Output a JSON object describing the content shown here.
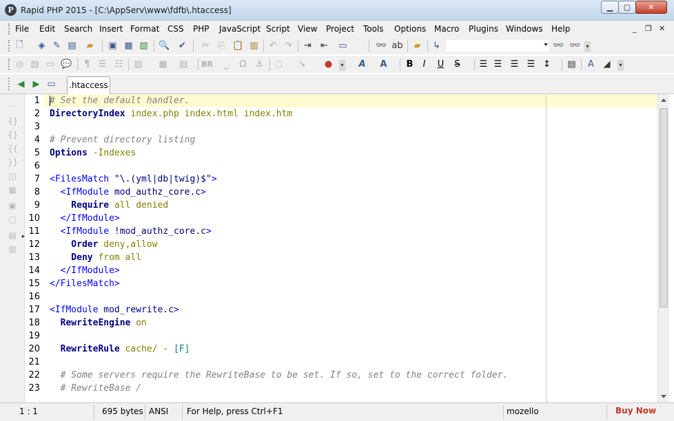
{
  "window": {
    "app_icon": "P",
    "title": "Rapid PHP 2015 - [C:\\AppServ\\www\\fdfb\\.htaccess]",
    "min_glyph": "▁",
    "max_glyph": "▢",
    "close_glyph": "✕"
  },
  "menu": {
    "items": [
      {
        "label": "File"
      },
      {
        "label": "Edit"
      },
      {
        "label": "Search"
      },
      {
        "label": "Insert"
      },
      {
        "label": "Format"
      },
      {
        "label": "CSS"
      },
      {
        "label": "PHP"
      },
      {
        "label": "JavaScript"
      },
      {
        "label": "Script"
      },
      {
        "label": "View"
      },
      {
        "label": "Project"
      },
      {
        "label": "Tools"
      },
      {
        "label": "Options"
      },
      {
        "label": "Macro"
      },
      {
        "label": "Plugins"
      },
      {
        "label": "Windows"
      },
      {
        "label": "Help"
      }
    ],
    "mdi_min": "_",
    "mdi_restore": "❐",
    "mdi_close": "✕"
  },
  "toolbar": {
    "format_labels": {
      "br": "BR",
      "bold": "B",
      "italic": "I",
      "underline": "U",
      "strike": "S",
      "font": "A",
      "size": "A"
    }
  },
  "tabs": [
    {
      "label": ".htaccess",
      "active": true
    }
  ],
  "editor": {
    "lines": [
      {
        "n": "1",
        "parts": [
          {
            "t": "# Set the default handler.",
            "c": "com"
          }
        ]
      },
      {
        "n": "2",
        "parts": [
          {
            "t": "DirectoryIndex",
            "c": "dir"
          },
          {
            "t": " index.php index.html index.htm",
            "c": "arg"
          }
        ]
      },
      {
        "n": "3",
        "parts": []
      },
      {
        "n": "4",
        "parts": [
          {
            "t": "# Prevent directory listing",
            "c": "com"
          }
        ]
      },
      {
        "n": "5",
        "parts": [
          {
            "t": "Options",
            "c": "dir"
          },
          {
            "t": " -Indexes",
            "c": "arg"
          }
        ]
      },
      {
        "n": "6",
        "parts": []
      },
      {
        "n": "7",
        "parts": [
          {
            "t": "<FilesMatch ",
            "c": "tag"
          },
          {
            "t": "\"\\.(yml|db|twig)$\"",
            "c": "str"
          },
          {
            "t": ">",
            "c": "tag"
          }
        ]
      },
      {
        "n": "8",
        "parts": [
          {
            "t": "  <IfModule ",
            "c": "tag"
          },
          {
            "t": "mod_authz_core.c",
            "c": "str"
          },
          {
            "t": ">",
            "c": "tag"
          }
        ]
      },
      {
        "n": "9",
        "parts": [
          {
            "t": "    Require",
            "c": "dir"
          },
          {
            "t": " all denied",
            "c": "arg"
          }
        ]
      },
      {
        "n": "10",
        "parts": [
          {
            "t": "  </IfModule>",
            "c": "tag"
          }
        ]
      },
      {
        "n": "11",
        "parts": [
          {
            "t": "  <IfModule ",
            "c": "tag"
          },
          {
            "t": "!mod_authz_core.c",
            "c": "str"
          },
          {
            "t": ">",
            "c": "tag"
          }
        ]
      },
      {
        "n": "12",
        "parts": [
          {
            "t": "    Order",
            "c": "dir"
          },
          {
            "t": " deny,allow",
            "c": "arg"
          }
        ]
      },
      {
        "n": "13",
        "parts": [
          {
            "t": "    Deny",
            "c": "dir"
          },
          {
            "t": " from all",
            "c": "arg"
          }
        ]
      },
      {
        "n": "14",
        "parts": [
          {
            "t": "  </IfModule>",
            "c": "tag"
          }
        ]
      },
      {
        "n": "15",
        "parts": [
          {
            "t": "</FilesMatch>",
            "c": "tag"
          }
        ]
      },
      {
        "n": "16",
        "parts": []
      },
      {
        "n": "17",
        "parts": [
          {
            "t": "<IfModule ",
            "c": "tag"
          },
          {
            "t": "mod_rewrite.c",
            "c": "str"
          },
          {
            "t": ">",
            "c": "tag"
          }
        ]
      },
      {
        "n": "18",
        "parts": [
          {
            "t": "  RewriteEngine",
            "c": "dir"
          },
          {
            "t": " on",
            "c": "arg"
          }
        ]
      },
      {
        "n": "19",
        "parts": []
      },
      {
        "n": "20",
        "parts": [
          {
            "t": "  RewriteRule",
            "c": "dir"
          },
          {
            "t": " cache/ - ",
            "c": "arg"
          },
          {
            "t": "[F]",
            "c": "op"
          }
        ]
      },
      {
        "n": "21",
        "parts": []
      },
      {
        "n": "22",
        "parts": [
          {
            "t": "  # Some servers require the RewriteBase to be set. If so, set to the correct folder.",
            "c": "com"
          }
        ]
      },
      {
        "n": "23",
        "parts": [
          {
            "t": "  # RewriteBase /",
            "c": "com"
          }
        ]
      }
    ]
  },
  "status": {
    "position": "1 : 1",
    "size": "695 bytes",
    "encoding": "ANSI",
    "hint": "For Help, press Ctrl+F1",
    "theme": "mozello",
    "buy": "Buy Now"
  }
}
